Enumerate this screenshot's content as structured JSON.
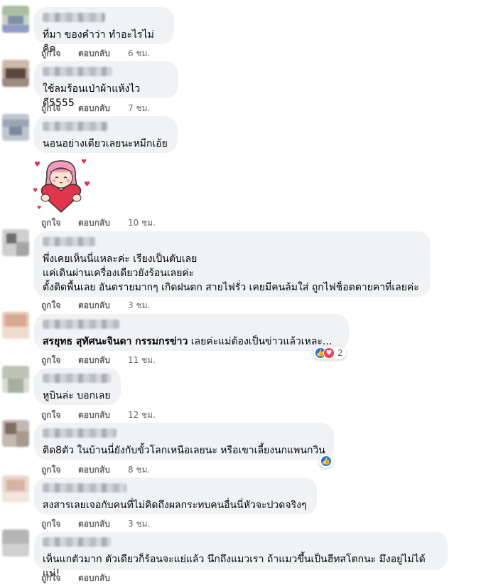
{
  "comments": [
    {
      "text": "ที่มา ของคำว่า ทำอะไรไม่คิด",
      "like": "ถูกใจ",
      "reply": "ตอบกลับ",
      "time": "6 ชม."
    },
    {
      "text": "ใช้ลมร้อนเป่าผ้าแห้งไวดี5555",
      "like": "ถูกใจ",
      "reply": "ตอบกลับ",
      "time": "7 ชม."
    },
    {
      "text": "นอนอย่างเดียวเลยนะหมีกเอ้ย",
      "like": "ถูกใจ",
      "reply": "ตอบกลับ",
      "time": "10 ชม.",
      "sticker": "girl-holding-heart-sticker"
    },
    {
      "text": "พึ่งเคยเห็นนี่แหละค่ะ เรียงเป็นตับเลย\nแค่เดินผ่านเครื่องเดียวยังร้อนเลยค่ะ\nตั้งติดพื้นเลย อันตรายมากๆ เกิดฝนตก สายไฟรั่ว เคยมีคนล้มใส่ ถูกไฟช็อตตายคาที่เลยค่ะ",
      "like": "ถูกใจ",
      "reply": "ตอบกลับ",
      "time": "3 ชม."
    },
    {
      "author": "สรยุทธ สุทัศนะจินดา กรรมกรข่าว",
      "text": "เลยค่ะแม่ต้องเป็นข่าวแล้วเหละ...",
      "like": "ถูกใจ",
      "reply": "ตอบกลับ",
      "time": "11 ชม.",
      "reaction_count": "2"
    },
    {
      "text": "หูบินล่ะ บอกเลย",
      "like": "ถูกใจ",
      "reply": "ตอบกลับ",
      "time": "12 ชม."
    },
    {
      "text": "ติด8ตัว ในบ้านนี่ยังกับขั้วโลกเหนือเลยนะ หรือเขาเลี้ยงนกแพนกวิน",
      "like": "ถูกใจ",
      "reply": "ตอบกลับ",
      "time": "8 ชม."
    },
    {
      "text": "สงสารเลยเจอกับคนที่ไม่คิดถึงผลกระทบคนอื่นนี่หัวจะปวดจริงๆ",
      "like": "ถูกใจ",
      "reply": "ตอบกลับ",
      "time": "3 ชม."
    },
    {
      "text": "เห็นแกตัวมาก ตัวเดียวก็ร้อนจะแย่แล้ว นึกถึงแมวเรา ถ้าแมวขึ้นเป็นฮีทสโตกนะ มึงอยู่ไม่ได้แน่!",
      "like": "ถูกใจ",
      "reply": "ตอบกลับ",
      "time": ""
    }
  ],
  "colors": {
    "bubble": "#f0f2f5",
    "meta": "#65676b",
    "like": "#1877f2",
    "love": "#f33e58"
  }
}
